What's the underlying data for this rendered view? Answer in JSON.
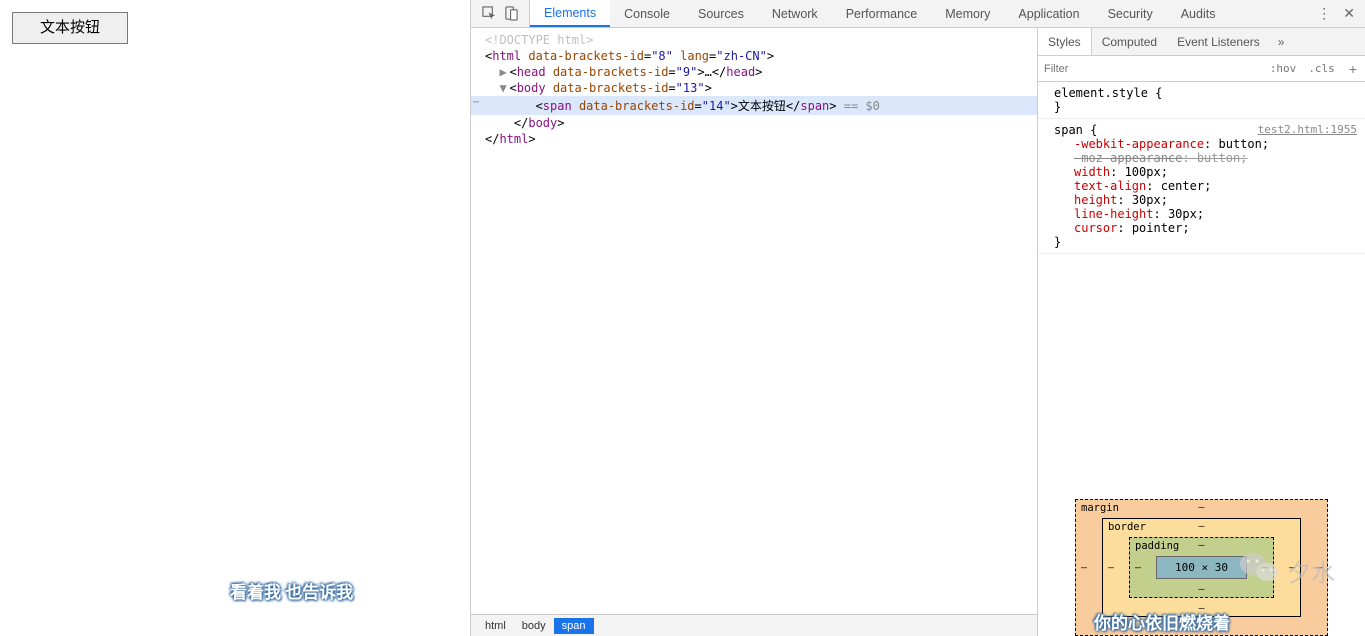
{
  "page": {
    "button_text": "文本按钮",
    "lyrics_left": "看着我  也告诉我",
    "lyrics_right": "你的心依旧燃烧着",
    "watermark": "夕水"
  },
  "devtools": {
    "tabs": [
      "Elements",
      "Console",
      "Sources",
      "Network",
      "Performance",
      "Memory",
      "Application",
      "Security",
      "Audits"
    ],
    "active_tab": "Elements"
  },
  "dom": {
    "doctype": "<!DOCTYPE html>",
    "html_open_tag": "html",
    "html_attrs": [
      [
        "data-brackets-id",
        "8"
      ],
      [
        "lang",
        "zh-CN"
      ]
    ],
    "head_tag": "head",
    "head_attrs": [
      [
        "data-brackets-id",
        "9"
      ]
    ],
    "head_ellipsis": "…",
    "body_tag": "body",
    "body_attrs": [
      [
        "data-brackets-id",
        "13"
      ]
    ],
    "span_tag": "span",
    "span_attrs": [
      [
        "data-brackets-id",
        "14"
      ]
    ],
    "span_text": "文本按钮",
    "eq_sel": " == $0"
  },
  "breadcrumb": [
    "html",
    "body",
    "span"
  ],
  "styles": {
    "tabs": [
      "Styles",
      "Computed",
      "Event Listeners"
    ],
    "filter_placeholder": "Filter",
    "hov": ":hov",
    "cls": ".cls",
    "element_style_label": "element.style",
    "rule": {
      "selector": "span",
      "source": "test2.html:1955",
      "props": [
        {
          "name": "-webkit-appearance",
          "value": "button",
          "struck": false
        },
        {
          "name": "-moz-appearance",
          "value": "button",
          "struck": true
        },
        {
          "name": "width",
          "value": "100px",
          "struck": false
        },
        {
          "name": "text-align",
          "value": "center",
          "struck": false
        },
        {
          "name": "height",
          "value": "30px",
          "struck": false
        },
        {
          "name": "line-height",
          "value": "30px",
          "struck": false
        },
        {
          "name": "cursor",
          "value": "pointer",
          "struck": false
        }
      ]
    }
  },
  "box_model": {
    "margin_label": "margin",
    "border_label": "border",
    "padding_label": "padding",
    "content": "100 × 30",
    "dash": "–"
  }
}
